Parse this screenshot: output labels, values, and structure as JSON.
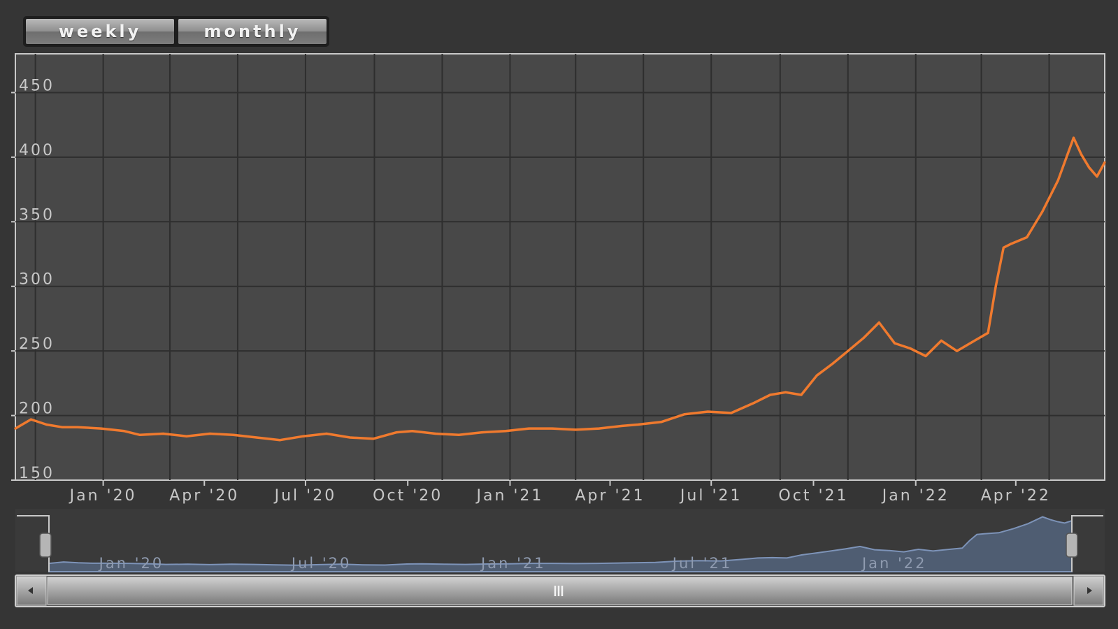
{
  "range_buttons": [
    {
      "label": "weekly"
    },
    {
      "label": "monthly"
    }
  ],
  "colors": {
    "page_background": "#353535",
    "plot_background": "#484848",
    "grid": "#2e2e2e",
    "frame": "#c9c9c9",
    "series_line": "#f07a2e",
    "navigator_fill": "#4f5d72",
    "navigator_line": "#7d93b8"
  },
  "icons": [
    "scroll-left-arrow-icon",
    "scroll-right-arrow-icon",
    "scrollbar-grip-icon",
    "navigator-handle-left-icon",
    "navigator-handle-right-icon"
  ],
  "chart_data": {
    "type": "line",
    "title": "",
    "xlabel": "",
    "ylabel": "",
    "ylim": [
      150,
      480
    ],
    "xlim": [
      "2019-10-14",
      "2022-06-20"
    ],
    "y_ticks": [
      {
        "value": 150,
        "label": "150"
      },
      {
        "value": 200,
        "label": "200"
      },
      {
        "value": 250,
        "label": "250"
      },
      {
        "value": 300,
        "label": "300"
      },
      {
        "value": 350,
        "label": "350"
      },
      {
        "value": 400,
        "label": "400"
      },
      {
        "value": 450,
        "label": "450"
      }
    ],
    "x_ticks": [
      {
        "date": "2020-01-01",
        "label": "Jan '20"
      },
      {
        "date": "2020-04-01",
        "label": "Apr '20"
      },
      {
        "date": "2020-07-01",
        "label": "Jul '20"
      },
      {
        "date": "2020-10-01",
        "label": "Oct '20"
      },
      {
        "date": "2021-01-01",
        "label": "Jan '21"
      },
      {
        "date": "2021-04-01",
        "label": "Apr '21"
      },
      {
        "date": "2021-07-01",
        "label": "Jul '21"
      },
      {
        "date": "2021-10-01",
        "label": "Oct '21"
      },
      {
        "date": "2022-01-01",
        "label": "Jan '22"
      },
      {
        "date": "2022-04-01",
        "label": "Apr '22"
      }
    ],
    "navigator_labels": [
      {
        "date": "2020-01-01",
        "label": "Jan '20"
      },
      {
        "date": "2020-07-01",
        "label": "Jul '20"
      },
      {
        "date": "2021-01-01",
        "label": "Jan '21"
      },
      {
        "date": "2021-07-01",
        "label": "Jul '21"
      },
      {
        "date": "2022-01-01",
        "label": "Jan '22"
      }
    ],
    "grid": true,
    "legend": "none",
    "series": [
      {
        "x": [
          "2019-10-14",
          "2019-10-28",
          "2019-11-11",
          "2019-11-25",
          "2019-12-09",
          "2019-12-30",
          "2020-01-20",
          "2020-02-03",
          "2020-02-24",
          "2020-03-16",
          "2020-04-06",
          "2020-04-27",
          "2020-05-18",
          "2020-06-08",
          "2020-06-29",
          "2020-07-20",
          "2020-08-10",
          "2020-08-31",
          "2020-09-21",
          "2020-10-05",
          "2020-10-26",
          "2020-11-16",
          "2020-12-07",
          "2020-12-28",
          "2021-01-18",
          "2021-02-08",
          "2021-03-01",
          "2021-03-22",
          "2021-04-12",
          "2021-04-26",
          "2021-05-17",
          "2021-06-07",
          "2021-06-28",
          "2021-07-19",
          "2021-08-09",
          "2021-08-23",
          "2021-09-06",
          "2021-09-20",
          "2021-10-04",
          "2021-10-18",
          "2021-11-01",
          "2021-11-15",
          "2021-11-29",
          "2021-12-13",
          "2021-12-27",
          "2022-01-10",
          "2022-01-24",
          "2022-02-07",
          "2022-02-21",
          "2022-03-07",
          "2022-03-14",
          "2022-03-21",
          "2022-03-28",
          "2022-04-11",
          "2022-04-25",
          "2022-05-09",
          "2022-05-23",
          "2022-05-30",
          "2022-06-06",
          "2022-06-13",
          "2022-06-20"
        ],
        "values": [
          190,
          197,
          193,
          191,
          191,
          190,
          188,
          185,
          186,
          184,
          186,
          185,
          183,
          181,
          184,
          186,
          183,
          182,
          187,
          188,
          186,
          185,
          187,
          188,
          190,
          190,
          189,
          190,
          192,
          193,
          195,
          201,
          203,
          202,
          210,
          216,
          218,
          216,
          231,
          240,
          250,
          260,
          272,
          256,
          252,
          246,
          258,
          250,
          257,
          264,
          300,
          330,
          333,
          338,
          358,
          382,
          415,
          402,
          392,
          385,
          396
        ]
      }
    ]
  }
}
